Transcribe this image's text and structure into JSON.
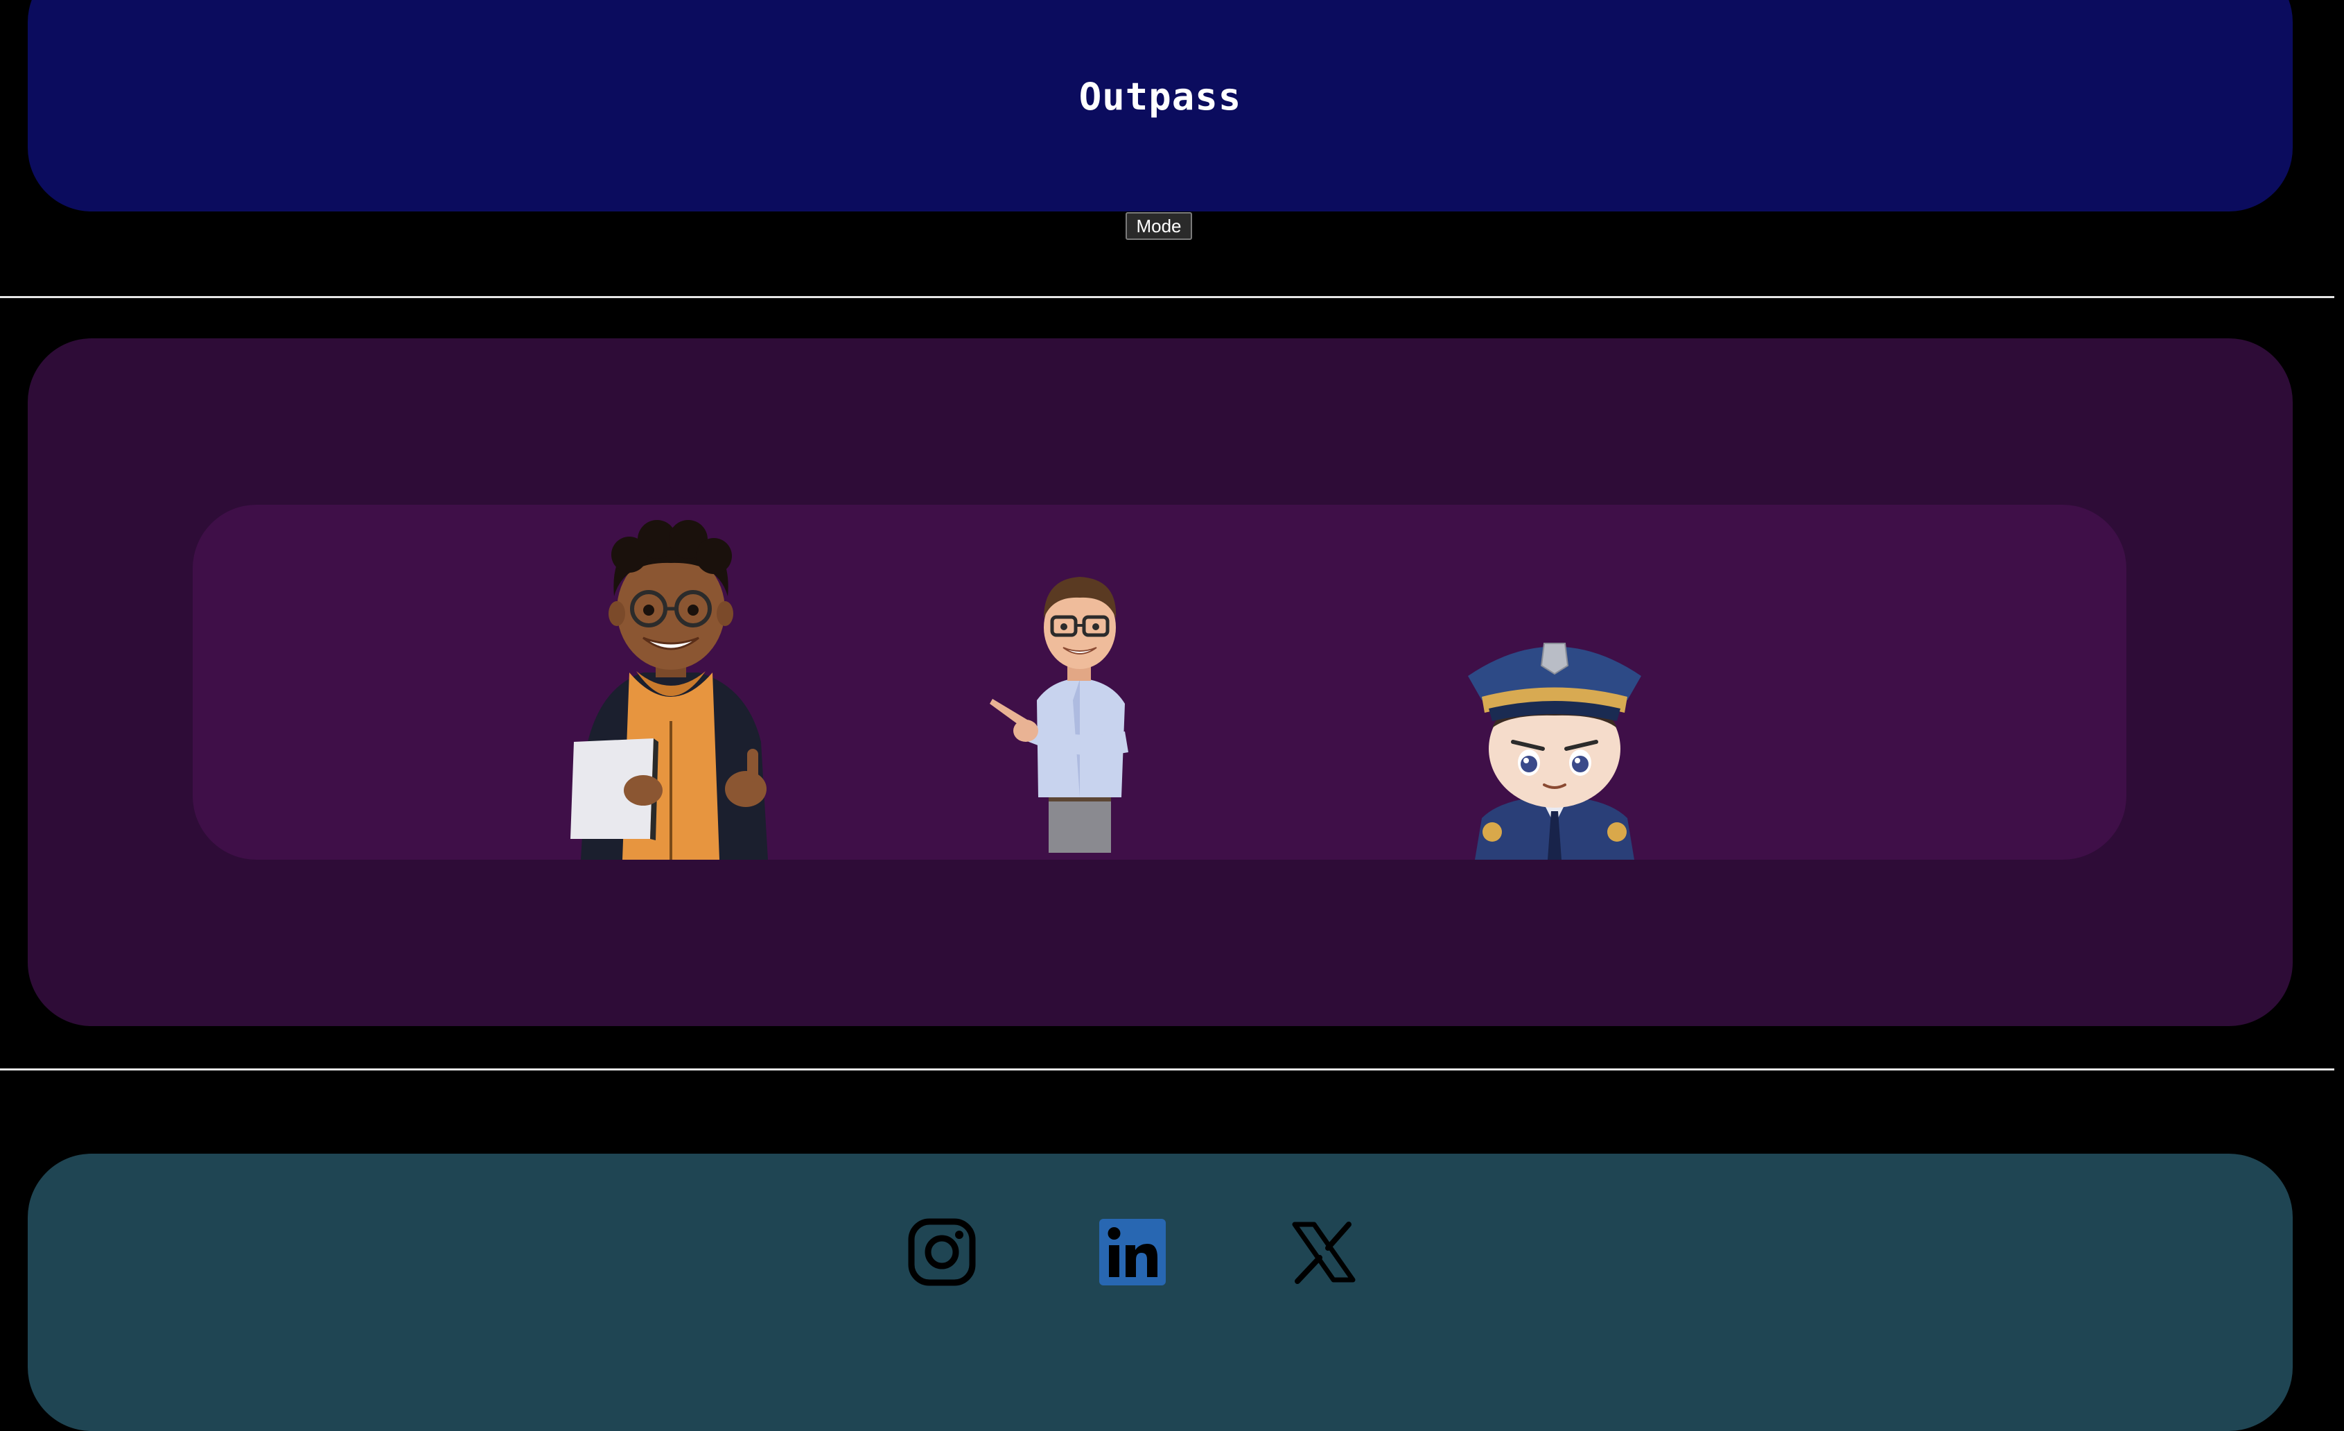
{
  "header": {
    "title": "Outpass",
    "mode_button_label": "Mode"
  },
  "hero": {
    "characters": [
      {
        "name": "student",
        "icon": "student-illustration"
      },
      {
        "name": "teacher",
        "icon": "teacher-illustration"
      },
      {
        "name": "guard",
        "icon": "police-officer-illustration"
      }
    ]
  },
  "footer": {
    "social_links": [
      {
        "name": "instagram",
        "icon": "instagram-icon"
      },
      {
        "name": "linkedin",
        "icon": "linkedin-icon"
      },
      {
        "name": "x",
        "icon": "x-icon"
      }
    ]
  },
  "colors": {
    "background": "#000000",
    "header_bg": "#0b0c5e",
    "hero_bg": "#2e0c37",
    "hero_inner_bg": "#3f0f48",
    "footer_bg": "#1f4553",
    "linkedin_blue": "#2867b2"
  }
}
